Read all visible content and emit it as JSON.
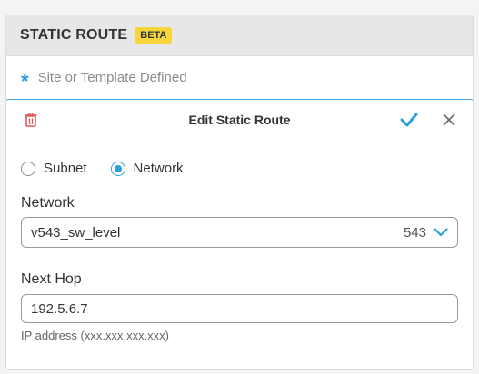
{
  "card": {
    "title": "STATIC ROUTE",
    "badge": "BETA",
    "defined_text": "Site or Template Defined"
  },
  "editor": {
    "title": "Edit Static Route",
    "radio_options": [
      {
        "label": "Subnet",
        "selected": false
      },
      {
        "label": "Network",
        "selected": true
      }
    ],
    "network": {
      "label": "Network",
      "value": "v543_sw_level",
      "vlan_id": "543"
    },
    "next_hop": {
      "label": "Next Hop",
      "value": "192.5.6.7",
      "hint": "IP address (xxx.xxx.xxx.xxx)"
    }
  },
  "colors": {
    "accent": "#2d9ee0",
    "badge": "#f7d63d",
    "delete": "#e05a5a"
  },
  "icons": {
    "delete": "trash-icon",
    "confirm": "checkmark-icon",
    "close": "close-icon",
    "dropdown": "chevron-down-icon",
    "required": "asterisk-icon"
  }
}
